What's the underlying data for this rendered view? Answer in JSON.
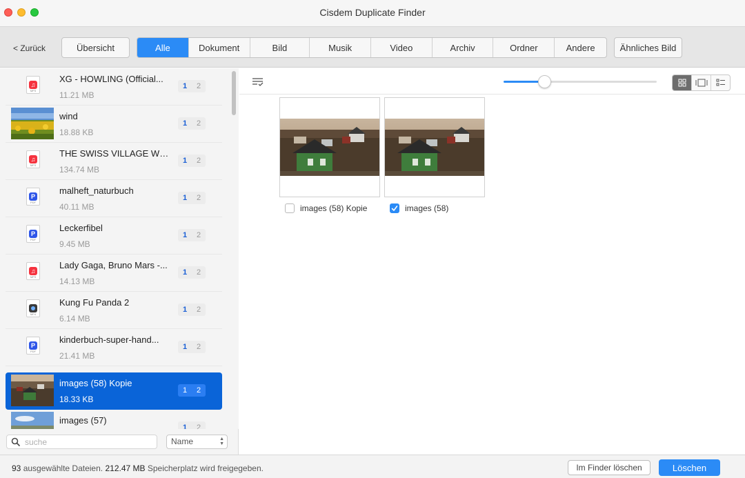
{
  "window": {
    "title": "Cisdem Duplicate Finder"
  },
  "toolbar": {
    "back_label": "< Zurück",
    "overview_label": "Übersicht",
    "similar_label": "Ähnliches Bild",
    "tabs": [
      {
        "label": "Alle",
        "active": true
      },
      {
        "label": "Dokument"
      },
      {
        "label": "Bild"
      },
      {
        "label": "Musik"
      },
      {
        "label": "Video"
      },
      {
        "label": "Archiv"
      },
      {
        "label": "Ordner"
      },
      {
        "label": "Andere"
      }
    ]
  },
  "sidebar": {
    "items": [
      {
        "name": "XG - HOWLING (Official...",
        "size": "11.21 MB",
        "icon": "music-file-icon",
        "ext": "MP3",
        "n1": "1",
        "n2": "2"
      },
      {
        "name": "wind",
        "size": "18.88 KB",
        "icon": "image-thumbnail",
        "n1": "1",
        "n2": "2"
      },
      {
        "name": "THE SWISS VILLAGE WH...",
        "size": "134.74 MB",
        "icon": "music-file-icon",
        "ext": "MP3",
        "n1": "1",
        "n2": "2"
      },
      {
        "name": "malheft_naturbuch",
        "size": "40.11 MB",
        "icon": "pdf-file-icon",
        "ext": "PDF",
        "n1": "1",
        "n2": "2"
      },
      {
        "name": "Leckerfibel",
        "size": "9.45 MB",
        "icon": "pdf-file-icon",
        "ext": "PDF",
        "n1": "1",
        "n2": "2"
      },
      {
        "name": "Lady Gaga, Bruno Mars -...",
        "size": "14.13 MB",
        "icon": "music-file-icon",
        "ext": "MP3",
        "n1": "1",
        "n2": "2"
      },
      {
        "name": "Kung Fu Panda 2",
        "size": "6.14 MB",
        "icon": "video-file-icon",
        "ext": "MP4",
        "n1": "1",
        "n2": "2"
      },
      {
        "name": "kinderbuch-super-hand...",
        "size": "21.41 MB",
        "icon": "pdf-file-icon",
        "ext": "PDF",
        "n1": "1",
        "n2": "2"
      },
      {
        "name": "images (58) Kopie",
        "size": "18.33 KB",
        "icon": "image-thumbnail",
        "selected": true,
        "n1": "1",
        "n2": "2"
      },
      {
        "name": "images (57)",
        "size": "",
        "icon": "image-thumbnail",
        "n1": "1",
        "n2": "2"
      }
    ],
    "search_placeholder": "suche",
    "sort_value": "Name"
  },
  "main": {
    "zoom_percent": 27,
    "view_mode": "grid",
    "cards": [
      {
        "label": "images (58) Kopie",
        "checked": false
      },
      {
        "label": "images (58)",
        "checked": true
      }
    ]
  },
  "status": {
    "count": "93",
    "count_text": "ausgewählte Dateien.",
    "size": "212.47 MB",
    "size_text": "Speicherplatz wird freigegeben.",
    "finder_delete_label": "Im Finder löschen",
    "delete_label": "Löschen"
  },
  "colors": {
    "accent": "#2b8bf6",
    "selection": "#0a64d8"
  }
}
